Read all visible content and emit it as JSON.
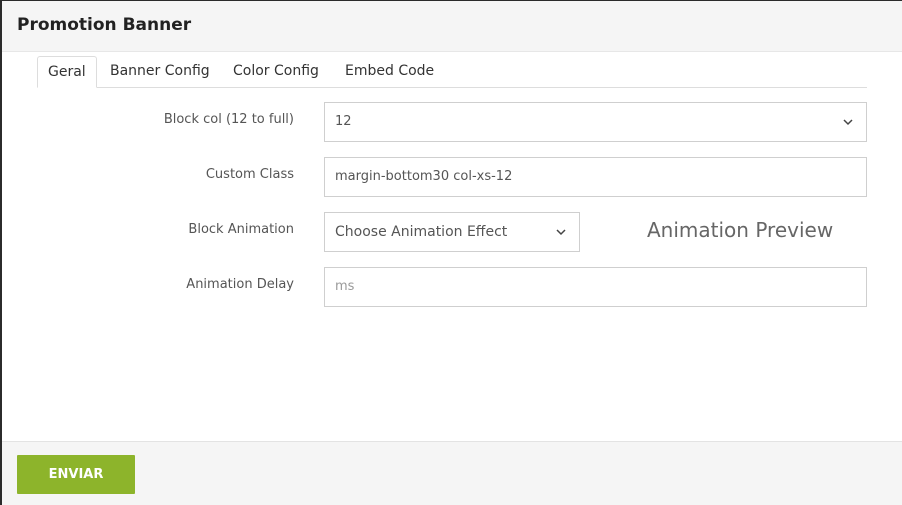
{
  "window": {
    "title": "Promotion Banner"
  },
  "tabs": [
    {
      "label": "Geral",
      "active": true
    },
    {
      "label": "Banner Config",
      "active": false
    },
    {
      "label": "Color Config",
      "active": false
    },
    {
      "label": "Embed Code",
      "active": false
    }
  ],
  "form": {
    "block_col": {
      "label": "Block col (12 to full)",
      "value": "12"
    },
    "custom_class": {
      "label": "Custom Class",
      "value": "margin-bottom30 col-xs-12"
    },
    "block_animation": {
      "label": "Block Animation",
      "placeholder": "Choose Animation Effect"
    },
    "animation_delay": {
      "label": "Animation Delay",
      "placeholder": "ms"
    },
    "preview_text": "Animation Preview"
  },
  "footer": {
    "submit_label": "ENVIAR"
  },
  "colors": {
    "accent": "#8db42b"
  },
  "icons": {
    "select_arrow": "chevron-down-icon"
  }
}
